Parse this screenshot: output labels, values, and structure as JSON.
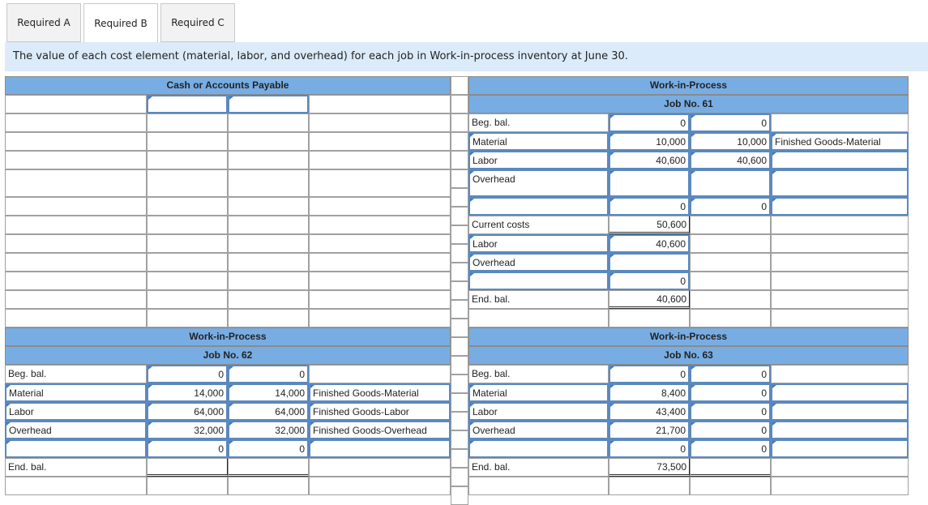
{
  "tabs": [
    {
      "label": "Required A"
    },
    {
      "label": "Required B"
    },
    {
      "label": "Required C"
    }
  ],
  "banner": "The value of each cost element (material, labor, and overhead) for each job in Work-in-process inventory at June 30.",
  "cash": {
    "title": "Cash or Accounts Payable"
  },
  "job61": {
    "title": "Work-in-Process",
    "job": "Job No. 61",
    "rows": [
      {
        "label": "Beg. bal.",
        "debit": "0",
        "credit": "0",
        "account": ""
      },
      {
        "label": "Material",
        "debit": "10,000",
        "credit": "10,000",
        "account": "Finished Goods-Material"
      },
      {
        "label": "Labor",
        "debit": "40,600",
        "credit": "40,600",
        "account": ""
      },
      {
        "label": "Overhead",
        "debit": "",
        "credit": "",
        "account": ""
      },
      {
        "label": "",
        "debit": "0",
        "credit": "0",
        "account": ""
      }
    ],
    "current_costs_label": "Current costs",
    "current_costs": "50,600",
    "rows2": [
      {
        "label": "Labor",
        "debit": "40,600"
      },
      {
        "label": "Overhead",
        "debit": ""
      },
      {
        "label": "",
        "debit": "0"
      }
    ],
    "end_label": "End. bal.",
    "end": "40,600"
  },
  "job62": {
    "title": "Work-in-Process",
    "job": "Job No. 62",
    "rows": [
      {
        "label": "Beg. bal.",
        "debit": "0",
        "credit": "0",
        "account": ""
      },
      {
        "label": "Material",
        "debit": "14,000",
        "credit": "14,000",
        "account": "Finished Goods-Material"
      },
      {
        "label": "Labor",
        "debit": "64,000",
        "credit": "64,000",
        "account": "Finished Goods-Labor"
      },
      {
        "label": "Overhead",
        "debit": "32,000",
        "credit": "32,000",
        "account": "Finished Goods-Overhead"
      },
      {
        "label": "",
        "debit": "0",
        "credit": "0",
        "account": ""
      }
    ],
    "end_label": "End. bal.",
    "end": ""
  },
  "job63": {
    "title": "Work-in-Process",
    "job": "Job No. 63",
    "rows": [
      {
        "label": "Beg. bal.",
        "debit": "0",
        "credit": "0",
        "account": ""
      },
      {
        "label": "Material",
        "debit": "8,400",
        "credit": "0",
        "account": ""
      },
      {
        "label": "Labor",
        "debit": "43,400",
        "credit": "0",
        "account": ""
      },
      {
        "label": "Overhead",
        "debit": "21,700",
        "credit": "0",
        "account": ""
      },
      {
        "label": "",
        "debit": "0",
        "credit": "0",
        "account": ""
      }
    ],
    "end_label": "End. bal.",
    "end": "73,500"
  }
}
